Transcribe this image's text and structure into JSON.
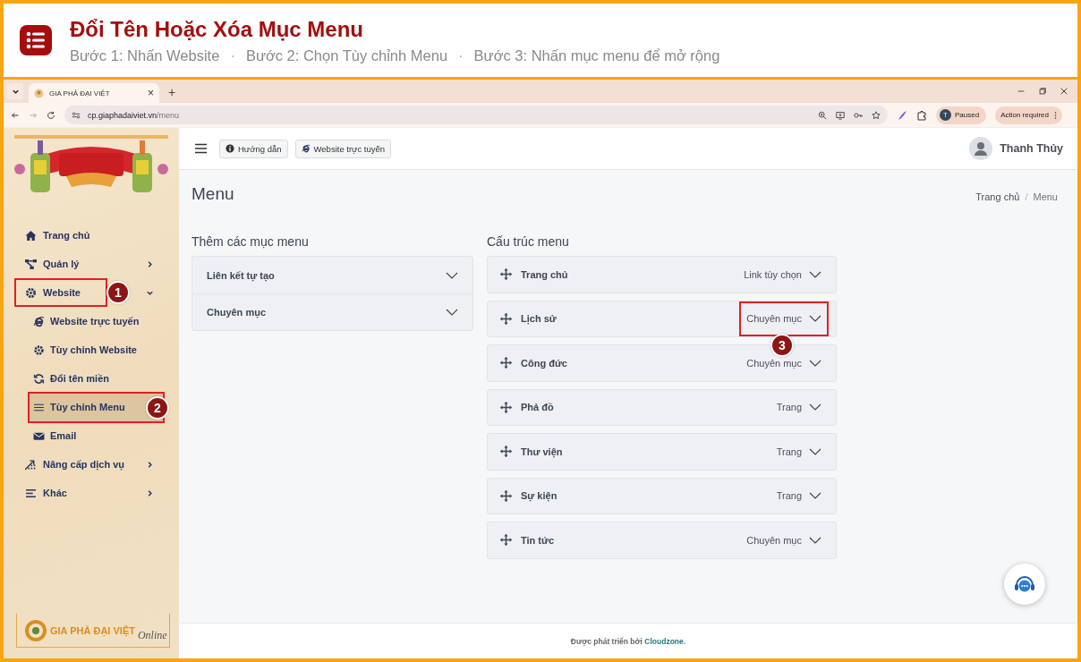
{
  "guide": {
    "title": "Đổi Tên Hoặc Xóa Mục Menu",
    "parts": [
      {
        "kind": "step",
        "text": "Bước 1: Nhấn Website"
      },
      {
        "kind": "separator",
        "text": "·"
      },
      {
        "kind": "step",
        "text": "Bước 2: Chọn Tùy chỉnh Menu"
      },
      {
        "kind": "separator",
        "text": "·"
      },
      {
        "kind": "step",
        "text": "Bước 3: Nhấn mục menu để mở rộng"
      }
    ]
  },
  "browser": {
    "tabs": [
      {
        "title": "GIA PHẢ ĐẠI VIỆT",
        "selected": true,
        "close": "×"
      }
    ],
    "new_tab": "+",
    "url_host": "cp.giaphadaiviet.vn",
    "url_path": "/menu",
    "profile": {
      "initial": "T",
      "label": "Paused"
    },
    "action": "Action required"
  },
  "sidebar": {
    "items": [
      {
        "label": "Trang chủ",
        "selected": false
      },
      {
        "label": "Quản lý",
        "selected": false,
        "expanded": false
      },
      {
        "label": "Website",
        "selected": false,
        "expanded": true,
        "highlighted": true,
        "step": "1",
        "children": [
          {
            "label": "Website trực tuyến",
            "selected": false
          },
          {
            "label": "Tùy chỉnh Website",
            "selected": false
          },
          {
            "label": "Đổi tên miền",
            "selected": false
          },
          {
            "label": "Tùy chỉnh Menu",
            "selected": true,
            "highlighted": true,
            "step": "2"
          },
          {
            "label": "Email",
            "selected": false
          }
        ]
      },
      {
        "label": "Nâng cấp dịch vụ",
        "selected": false,
        "expanded": false
      },
      {
        "label": "Khác",
        "selected": false,
        "expanded": false
      }
    ],
    "footer_logo": {
      "name": "GIA PHẢ ĐẠI VIỆT",
      "tagline": "Online"
    }
  },
  "topbar": {
    "buttons": [
      {
        "label": "Hướng dẫn"
      },
      {
        "label": "Website trực tuyến"
      }
    ],
    "user": "Thanh Thủy"
  },
  "page": {
    "title": "Menu",
    "breadcrumb": [
      {
        "label": "Trang chủ"
      },
      {
        "label": "Menu"
      }
    ],
    "breadcrumb_separator": "/"
  },
  "add_section": {
    "title": "Thêm các mục menu",
    "panels": [
      {
        "label": "Liên kết tự tạo",
        "expanded": false
      },
      {
        "label": "Chuyên mục",
        "expanded": false
      }
    ]
  },
  "structure": {
    "title": "Cấu trúc menu",
    "items": [
      {
        "name": "Trang chủ",
        "type": "Link tùy chọn",
        "highlighted": false
      },
      {
        "name": "Lịch sử",
        "type": "Chuyên mục",
        "highlighted": true,
        "step": "3"
      },
      {
        "name": "Công đức",
        "type": "Chuyên mục",
        "highlighted": false
      },
      {
        "name": "Phả đồ",
        "type": "Trang",
        "highlighted": false
      },
      {
        "name": "Thư viện",
        "type": "Trang",
        "highlighted": false
      },
      {
        "name": "Sự kiện",
        "type": "Trang",
        "highlighted": false
      },
      {
        "name": "Tin tức",
        "type": "Chuyên mục",
        "highlighted": false
      }
    ]
  },
  "footer": {
    "text": "Được phát triển bởi",
    "link": "Cloudzone",
    "end": "."
  }
}
